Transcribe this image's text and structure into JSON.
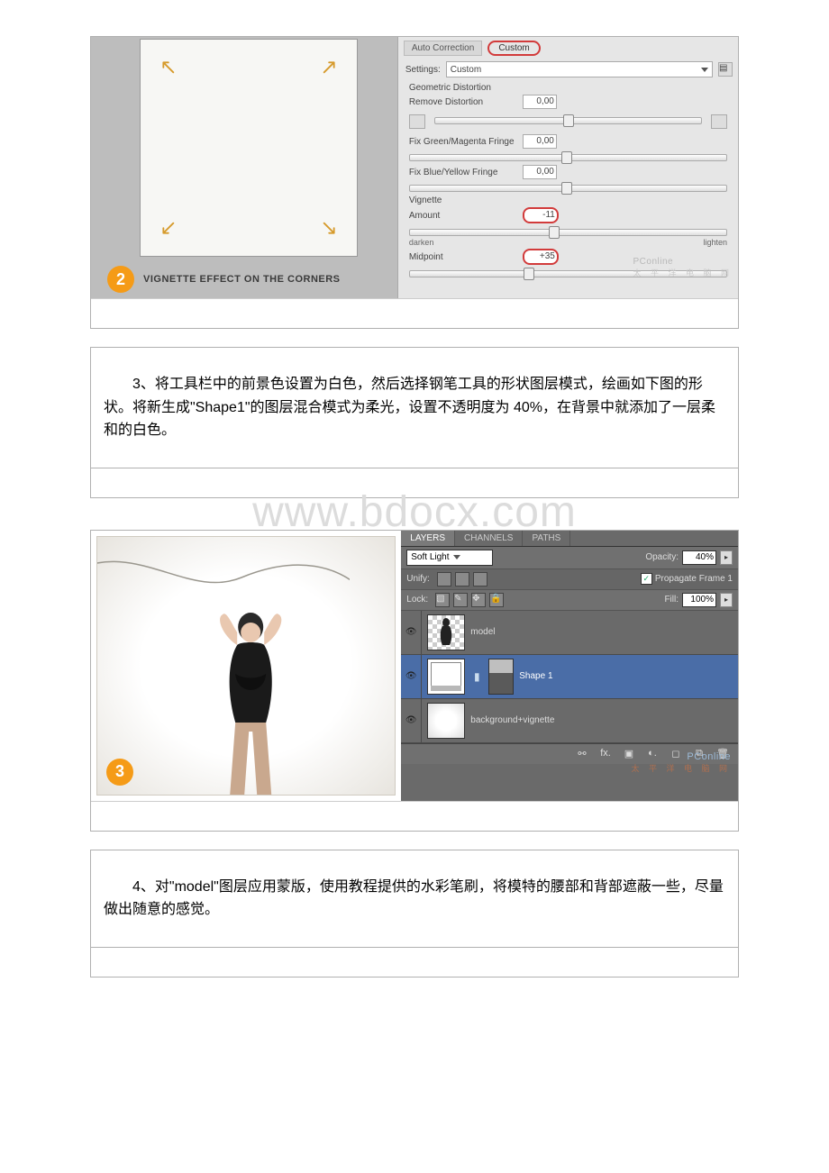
{
  "figure1": {
    "step_number": "2",
    "caption": "VIGNETTE EFFECT ON THE CORNERS",
    "tabs": {
      "auto": "Auto Correction",
      "custom": "Custom"
    },
    "settings_label": "Settings:",
    "settings_value": "Custom",
    "geo_heading": "Geometric Distortion",
    "remove_label": "Remove Distortion",
    "remove_value": "0,00",
    "fix_gm_label": "Fix Green/Magenta Fringe",
    "fix_gm_value": "0,00",
    "fix_by_label": "Fix Blue/Yellow Fringe",
    "fix_by_value": "0,00",
    "vignette_heading": "Vignette",
    "amount_label": "Amount",
    "amount_value": "-11",
    "darken_label": "darken",
    "lighten_label": "lighten",
    "midpoint_label": "Midpoint",
    "midpoint_value": "+35",
    "watermark1": "PConline",
    "watermark2": "太 平 洋 电 脑 网"
  },
  "para1": "3、将工具栏中的前景色设置为白色，然后选择钢笔工具的形状图层模式，绘画如下图的形状。将新生成\"Shape1\"的图层混合模式为柔光，设置不透明度为 40%，在背景中就添加了一层柔和的白色。",
  "big_watermark": "www.bdocx.com",
  "figure2": {
    "step_number": "3",
    "tabs": {
      "layers": "LAYERS",
      "channels": "CHANNELS",
      "paths": "PATHS"
    },
    "blend_mode": "Soft Light",
    "opacity_label": "Opacity:",
    "opacity_value": "40%",
    "unify_label": "Unify:",
    "propagate_label": "Propagate Frame 1",
    "lock_label": "Lock:",
    "fill_label": "Fill:",
    "fill_value": "100%",
    "layers": {
      "model": "model",
      "shape1": "Shape 1",
      "bg": "background+vignette"
    },
    "footer_icons": {
      "link": "⚯",
      "fx": "fx.",
      "mask": "▣",
      "adjust": "◐.",
      "group": "◻",
      "new": "⧉",
      "trash": "🗑"
    },
    "watermark1": "PConline",
    "watermark2": "太 平 洋 电 脑 网"
  },
  "para2": "4、对\"model\"图层应用蒙版，使用教程提供的水彩笔刷，将模特的腰部和背部遮蔽一些，尽量做出随意的感觉。"
}
